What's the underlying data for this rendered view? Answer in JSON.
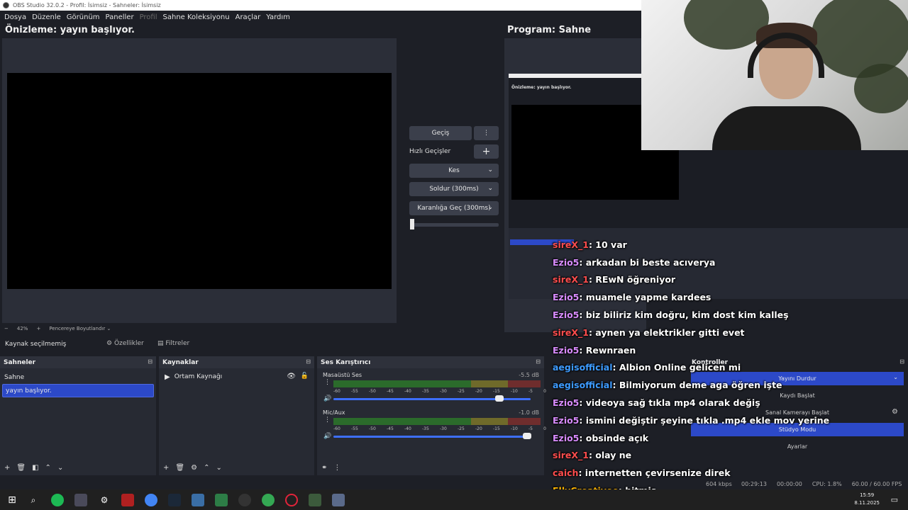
{
  "window": {
    "title": "OBS Studio 32.0.2 - Profil: İsimsiz - Sahneler: İsimsiz"
  },
  "menu": [
    {
      "label": "Dosya",
      "enabled": true
    },
    {
      "label": "Düzenle",
      "enabled": true
    },
    {
      "label": "Görünüm",
      "enabled": true
    },
    {
      "label": "Paneller",
      "enabled": true
    },
    {
      "label": "Profil",
      "enabled": false
    },
    {
      "label": "Sahne Koleksiyonu",
      "enabled": true
    },
    {
      "label": "Araçlar",
      "enabled": true
    },
    {
      "label": "Yardım",
      "enabled": true
    }
  ],
  "preview": {
    "title": "Önizleme: yayın başlıyor."
  },
  "program": {
    "title": "Program: Sahne"
  },
  "transitions": {
    "transition_button": "Geçiş",
    "quick_label": "Hızlı Geçişler",
    "cut": "Kes",
    "fade": "Soldur (300ms)",
    "fade_to_black": "Karanlığa Geç (300ms)",
    "tbar_value": 0.0
  },
  "zoom": {
    "minus": "−",
    "level": "42%",
    "plus": "+",
    "fit_label": "Pencereye Boyutlandır"
  },
  "context": {
    "no_source": "Kaynak seçilmemiş",
    "properties": "Özellikler",
    "filters": "Filtreler"
  },
  "scenes": {
    "title": "Sahneler",
    "items": [
      {
        "name": "Sahne",
        "selected": false
      },
      {
        "name": "yayın başlıyor.",
        "selected": true
      }
    ]
  },
  "sources": {
    "title": "Kaynaklar",
    "items": [
      {
        "name": "Ortam Kaynağı",
        "visible": true,
        "locked": false
      }
    ]
  },
  "mixer": {
    "title": "Ses Karıştırıcı",
    "ticks": [
      "-60",
      "-55",
      "-50",
      "-45",
      "-40",
      "-35",
      "-30",
      "-25",
      "-20",
      "-15",
      "-10",
      "-5",
      "0"
    ],
    "channels": [
      {
        "name": "Masaüstü Ses",
        "db": "-5.5 dB",
        "volume": 0.84
      },
      {
        "name": "Mic/Aux",
        "db": "-1.0 dB",
        "volume": 0.98
      }
    ]
  },
  "controls": {
    "title": "Kontroller",
    "stop_stream": "Yayını Durdur",
    "start_recording": "Kaydı Başlat",
    "start_virtual_camera": "Sanal Kamerayı Başlat",
    "studio_mode": "Stüdyo Modu",
    "settings": "Ayarlar"
  },
  "chat": [
    {
      "user": "sireX_1",
      "text": " : 10 var",
      "color": "#ff4d4d"
    },
    {
      "user": "Ezio5",
      "text": " : arkadan bi beste acıverya",
      "color": "#d98cff"
    },
    {
      "user": "sireX_1",
      "text": " : REwN öğreniyor",
      "color": "#ff4d4d"
    },
    {
      "user": "Ezio5",
      "text": " : muamele yapme kardees",
      "color": "#d98cff"
    },
    {
      "user": "Ezio5",
      "text": " : biz biliriz kim doğru, kim dost kim kalleş",
      "color": "#d98cff"
    },
    {
      "user": "sireX_1",
      "text": " : aynen ya elektrikler gitti evet",
      "color": "#ff4d4d"
    },
    {
      "user": "Ezio5",
      "text": " : Rewnraen",
      "color": "#d98cff"
    },
    {
      "user": "aegisofficial",
      "text": " : Albion Online gelicen mi",
      "color": "#3d9bff"
    },
    {
      "user": "aegisofficial",
      "text": " : Bilmiyorum deme aga öğren işte",
      "color": "#3d9bff"
    },
    {
      "user": "Ezio5",
      "text": " : videoya sağ tıkla mp4 olarak değiş",
      "color": "#d98cff"
    },
    {
      "user": "Ezio5",
      "text": " : ismini değiştir şeyine tıkla .mp4 ekle mov yerine",
      "color": "#d98cff"
    },
    {
      "user": "Ezio5",
      "text": " : obsinde açık",
      "color": "#d98cff"
    },
    {
      "user": "sireX_1",
      "text": " : olay ne",
      "color": "#ff4d4d"
    },
    {
      "user": "caich",
      "text": " : internetten çevirsenize direk",
      "color": "#ff4d4d"
    },
    {
      "user": "EllyCreativee",
      "text": " : bitmiş",
      "color": "#ffb400"
    }
  ],
  "status": {
    "bitrate": "604 kbps",
    "stream_time": "00:29:13",
    "record_time": "00:00:00",
    "cpu": "CPU: 1.8%",
    "fps": "60.00 / 60.00 FPS"
  },
  "taskbar": {
    "time": "15:59",
    "date": "8.11.2025"
  }
}
